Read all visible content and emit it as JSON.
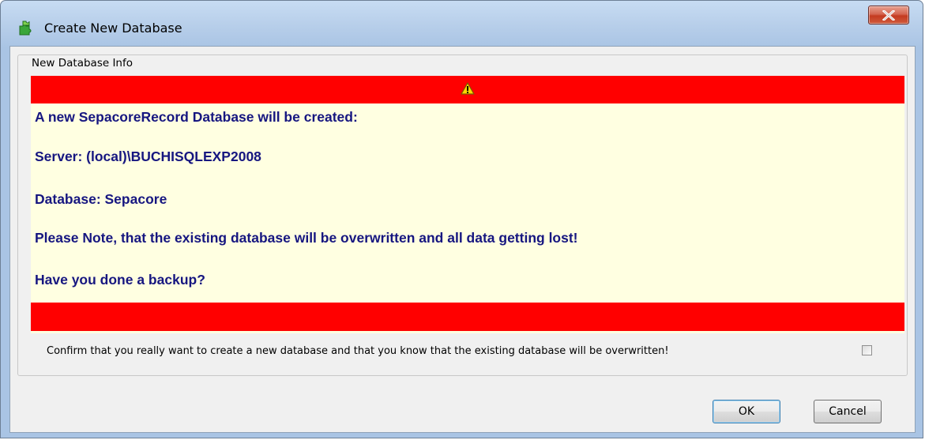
{
  "window": {
    "title": "Create New Database",
    "close_icon": "close-icon"
  },
  "groupbox": {
    "legend": "New Database Info"
  },
  "warning": {
    "icon": "warning-icon",
    "lines": [
      "A new SepacoreRecord Database will be created:",
      "Server:  (local)\\BUCHISQLEXP2008",
      "Database:  Sepacore",
      "Please Note, that the existing database will be overwritten and all data getting lost!",
      "Have you done a backup?"
    ],
    "band_color": "#ff0000",
    "panel_color": "#ffffe1",
    "text_color": "#161680"
  },
  "confirm": {
    "label": "Confirm that you really want to create a new database and that you know that the existing database will be overwritten!",
    "checked": false
  },
  "buttons": {
    "ok_label": "OK",
    "cancel_label": "Cancel"
  }
}
